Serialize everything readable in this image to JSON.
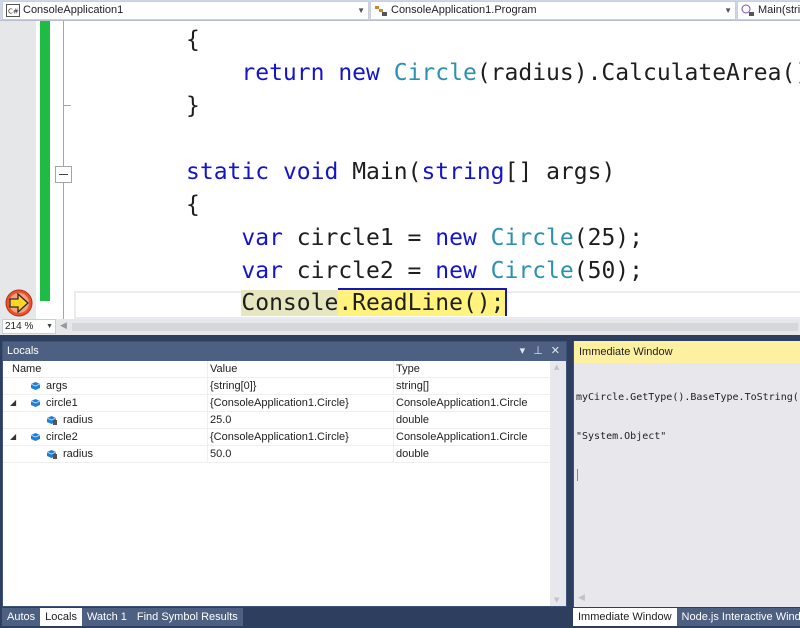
{
  "navbar": {
    "project": "ConsoleApplication1",
    "type": "ConsoleApplication1.Program",
    "member": "Main(string[] args)"
  },
  "editor": {
    "lines": [
      {
        "indent": 0,
        "tokens": [
          {
            "t": "{",
            "c": "p"
          }
        ]
      },
      {
        "indent": 1,
        "tokens": [
          {
            "t": "return ",
            "c": "kw"
          },
          {
            "t": "new ",
            "c": "kw"
          },
          {
            "t": "Circle",
            "c": "ty"
          },
          {
            "t": "(radius).CalculateArea();",
            "c": "p"
          }
        ]
      },
      {
        "indent": 0,
        "tokens": [
          {
            "t": "}",
            "c": "p"
          }
        ]
      },
      {
        "indent": 0,
        "tokens": []
      },
      {
        "indent": 0,
        "tokens": [
          {
            "t": "static ",
            "c": "kw"
          },
          {
            "t": "void ",
            "c": "kw"
          },
          {
            "t": "Main(",
            "c": "p"
          },
          {
            "t": "string",
            "c": "kw"
          },
          {
            "t": "[] args)",
            "c": "p"
          }
        ]
      },
      {
        "indent": 0,
        "tokens": [
          {
            "t": "{",
            "c": "p"
          }
        ]
      },
      {
        "indent": 1,
        "tokens": [
          {
            "t": "var ",
            "c": "kw"
          },
          {
            "t": "circle1 = ",
            "c": "p"
          },
          {
            "t": "new ",
            "c": "kw"
          },
          {
            "t": "Circle",
            "c": "ty"
          },
          {
            "t": "(25);",
            "c": "p"
          }
        ]
      },
      {
        "indent": 1,
        "tokens": [
          {
            "t": "var ",
            "c": "kw"
          },
          {
            "t": "circle2 = ",
            "c": "p"
          },
          {
            "t": "new ",
            "c": "kw"
          },
          {
            "t": "Circle",
            "c": "ty"
          },
          {
            "t": "(50);",
            "c": "p"
          }
        ]
      }
    ],
    "current_line": {
      "part1": "Console",
      "part2": ".ReadLine();"
    },
    "zoom_level": "214 %"
  },
  "locals": {
    "title": "Locals",
    "columns": [
      "Name",
      "Value",
      "Type"
    ],
    "rows": [
      {
        "name": "args",
        "value": "{string[0]}",
        "type": "string[]",
        "level": 0,
        "expander": "",
        "icon": "object-icon"
      },
      {
        "name": "circle1",
        "value": "{ConsoleApplication1.Circle}",
        "type": "ConsoleApplication1.Circle",
        "level": 0,
        "expander": "◢",
        "icon": "object-icon"
      },
      {
        "name": "radius",
        "value": "25.0",
        "type": "double",
        "level": 1,
        "expander": "",
        "icon": "private-field-icon"
      },
      {
        "name": "circle2",
        "value": "{ConsoleApplication1.Circle}",
        "type": "ConsoleApplication1.Circle",
        "level": 0,
        "expander": "◢",
        "icon": "object-icon"
      },
      {
        "name": "radius",
        "value": "50.0",
        "type": "double",
        "level": 1,
        "expander": "",
        "icon": "private-field-icon"
      }
    ],
    "title_buttons": {
      "dropdown": "▾",
      "pin": "⊥",
      "close": "✕"
    }
  },
  "bottom_tabs_left": [
    {
      "label": "Autos",
      "active": false
    },
    {
      "label": "Locals",
      "active": true
    },
    {
      "label": "Watch 1",
      "active": false
    },
    {
      "label": "Find Symbol Results",
      "active": false
    }
  ],
  "immediate": {
    "title": "Immediate Window",
    "lines": [
      "myCircle.GetType().BaseType.ToString()",
      "\"System.Object\""
    ]
  },
  "bottom_tabs_right": [
    {
      "label": "Immediate Window",
      "active": true
    },
    {
      "label": "Node.js Interactive Window",
      "active": false
    }
  ]
}
